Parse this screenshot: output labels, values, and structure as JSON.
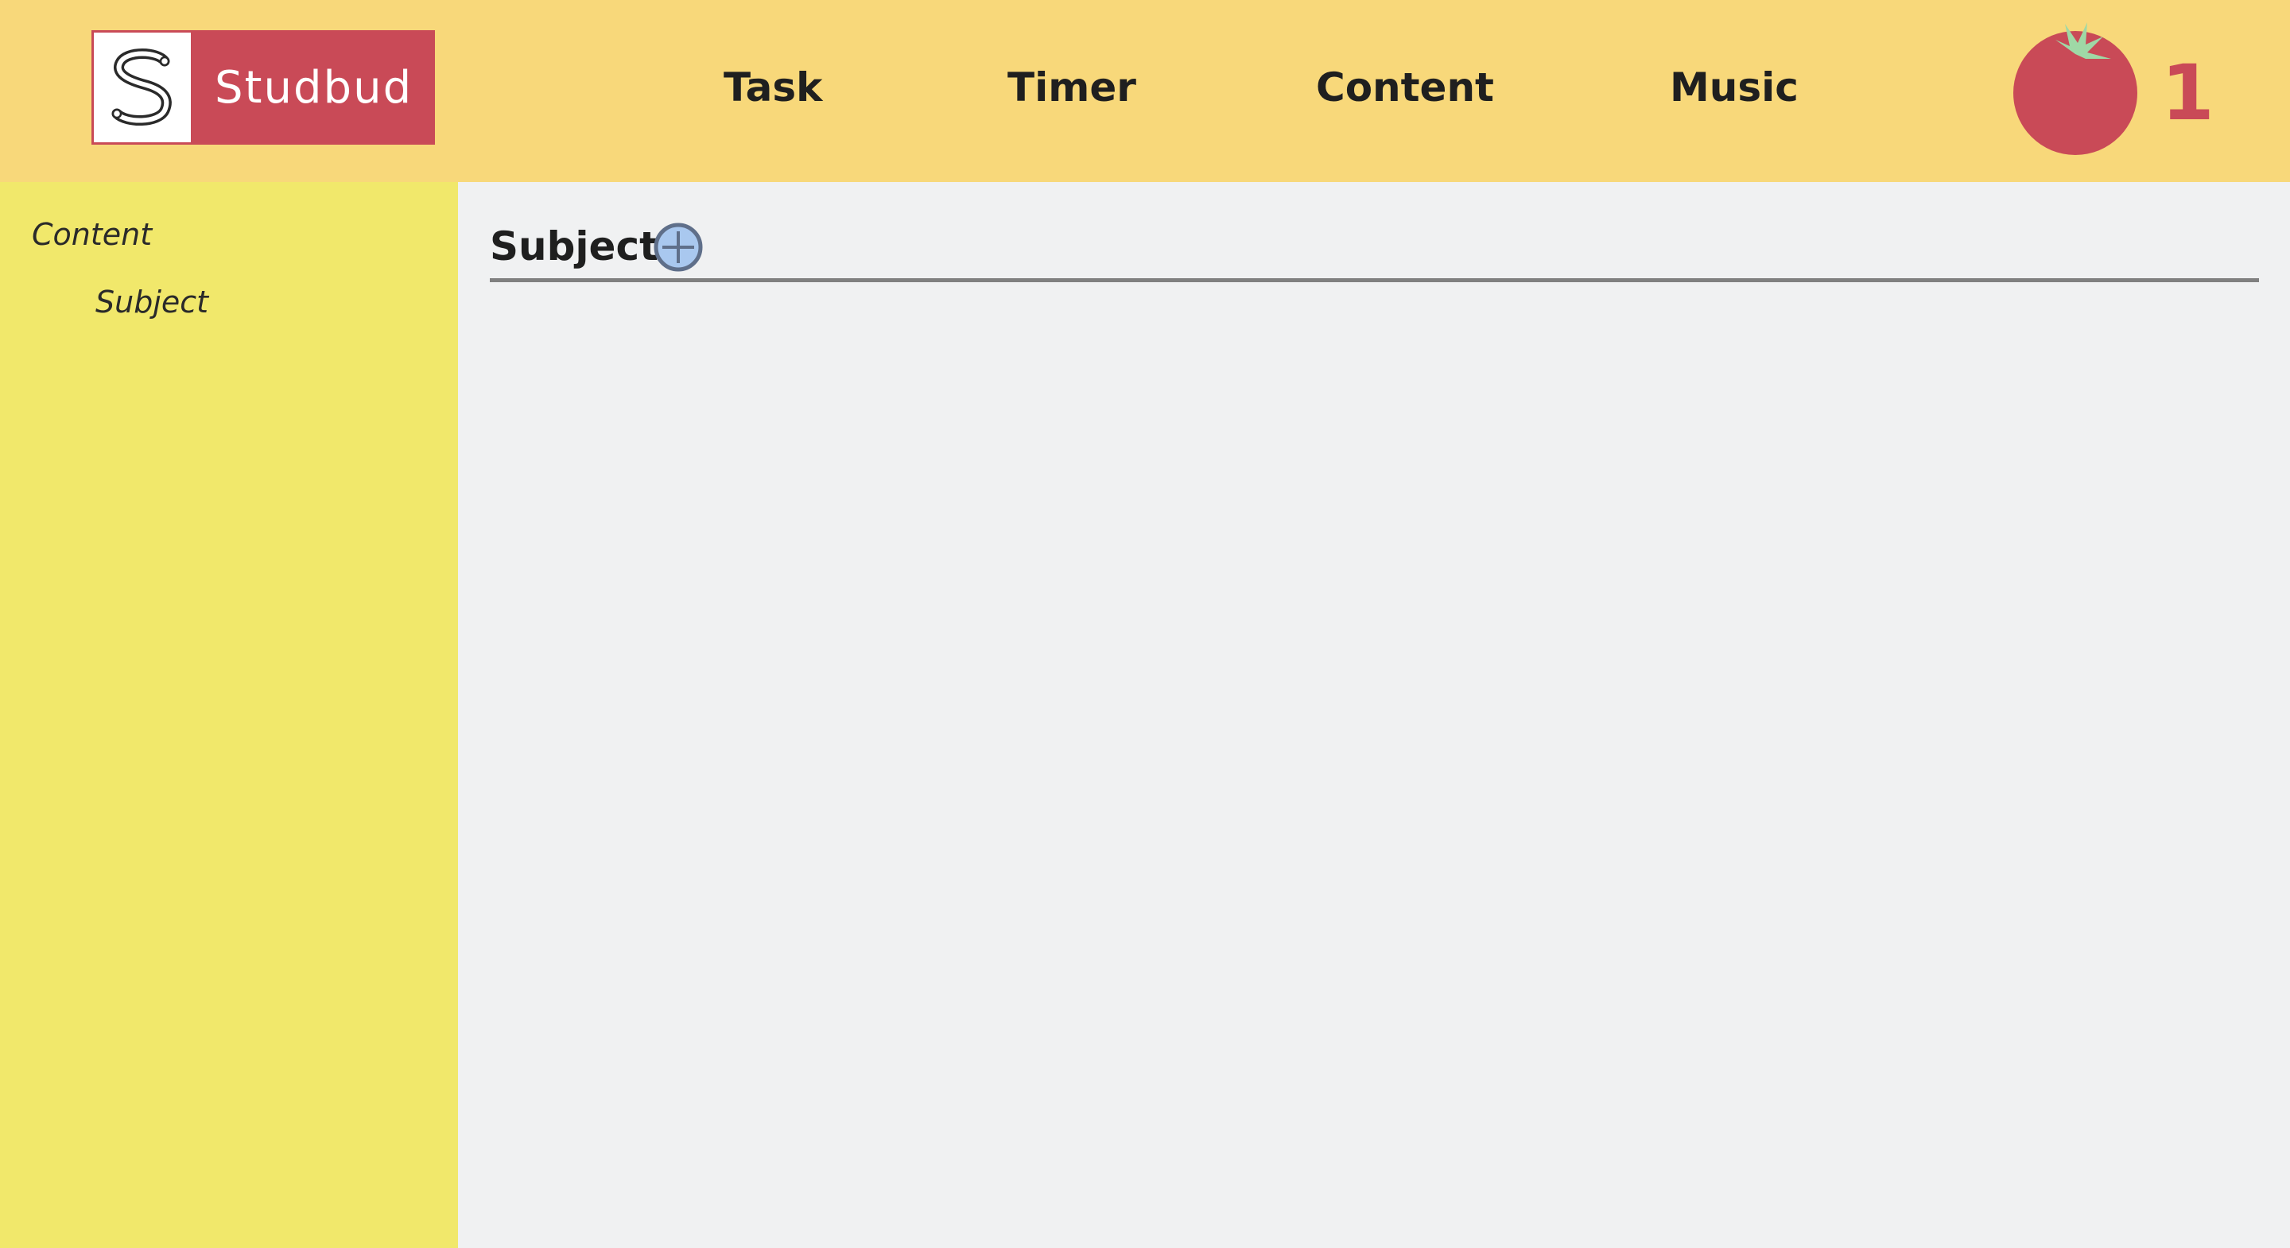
{
  "header": {
    "logo_text": "Studbud",
    "nav": {
      "task": "Task",
      "timer": "Timer",
      "content": "Content",
      "music": "Music"
    },
    "pomodoro_count": "1",
    "tomato_icon": "tomato-icon"
  },
  "sidebar": {
    "items": [
      {
        "label": "Content"
      },
      {
        "label": "Subject"
      }
    ]
  },
  "main": {
    "section_title": "Subject",
    "add_icon": "plus-circle-icon"
  },
  "colors": {
    "header_bg": "#f8d87a",
    "sidebar_bg": "#f1e86b",
    "main_bg": "#f0f1f2",
    "brand_red": "#c94a57",
    "add_button_fill": "#a9c8ef"
  }
}
